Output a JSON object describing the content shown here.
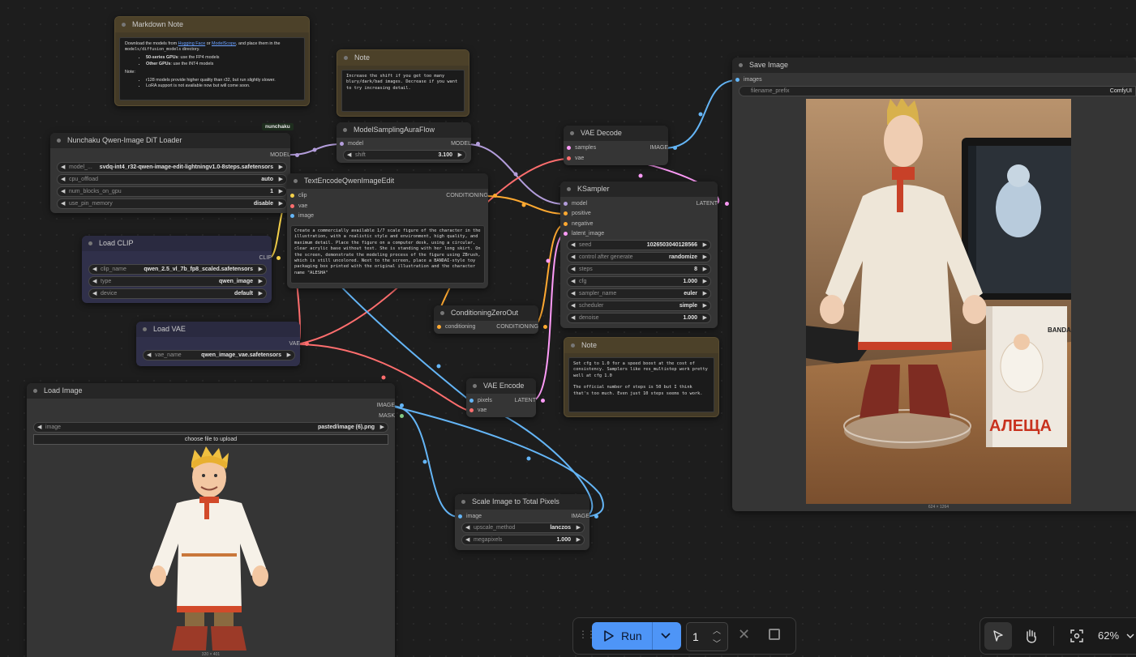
{
  "nodes": {
    "markdown_note": {
      "title": "Markdown Note",
      "p1_prefix": "Download the models from ",
      "link1": "Hugging Face",
      "p1_or": " or ",
      "link2": "ModelScope",
      "p1_suffix": ", and place them in the ",
      "p1_code": "models/diffusion_models",
      "p1_end": " directory.",
      "li1_bold": "50-series GPUs",
      "li1_rest": ": use the FP4 models",
      "li2_bold": "Other GPUs",
      "li2_rest": ": use the INT4 models",
      "note_label": "Note:",
      "li3": "r128 models provide higher quality than r32, but run slightly slower.",
      "li4": "LoRA support is not available now but will come soon."
    },
    "note_shift": {
      "title": "Note",
      "text": "Increase the shift if you get too many blury/dark/bad images. Decrease if you want to try increasing detail."
    },
    "badge": "nunchaku",
    "dit_loader": {
      "title": "Nunchaku Qwen-Image DiT Loader",
      "out": "MODEL",
      "widgets": [
        {
          "label": "model_...",
          "value": "svdq-int4_r32-qwen-image-edit-lightningv1.0-8steps.safetensors"
        },
        {
          "label": "cpu_offload",
          "value": "auto"
        },
        {
          "label": "num_blocks_on_gpu",
          "value": "1"
        },
        {
          "label": "use_pin_memory",
          "value": "disable"
        }
      ]
    },
    "model_sampling": {
      "title": "ModelSamplingAuraFlow",
      "in_model": "model",
      "out_model": "MODEL",
      "widget_label": "shift",
      "widget_value": "3.100"
    },
    "text_encode": {
      "title": "TextEncodeQwenImageEdit",
      "in_clip": "clip",
      "in_vae": "vae",
      "in_image": "image",
      "out": "CONDITIONING",
      "prompt": "Create a commercially available 1/7 scale figure of the character in the illustration, with a realistic style and environment, high quality, and maximum detail. Place the figure on a computer desk, using a circular, clear acrylic base without text. She is standing with her long skirt. On the screen, demonstrate the modeling process of the figure using ZBrush, which is still uncolored. Next to the screen, place a BANDAI-style toy packaging box printed with the original illustration and the character name \"ALESHA\""
    },
    "load_clip": {
      "title": "Load CLIP",
      "out": "CLIP",
      "widgets": [
        {
          "label": "clip_name",
          "value": "qwen_2.5_vl_7b_fp8_scaled.safetensors"
        },
        {
          "label": "type",
          "value": "qwen_image"
        },
        {
          "label": "device",
          "value": "default"
        }
      ]
    },
    "load_vae": {
      "title": "Load VAE",
      "out": "VAE",
      "widget_label": "vae_name",
      "widget_value": "qwen_image_vae.safetensors"
    },
    "load_image": {
      "title": "Load Image",
      "out_image": "IMAGE",
      "out_mask": "MASK",
      "widget_label": "image",
      "widget_value": "pasted/image (6).png",
      "upload_label": "choose file to upload",
      "caption": "320 × 401"
    },
    "vae_decode": {
      "title": "VAE Decode",
      "in_samples": "samples",
      "in_vae": "vae",
      "out": "IMAGE"
    },
    "ksampler": {
      "title": "KSampler",
      "in_model": "model",
      "in_positive": "positive",
      "in_negative": "negative",
      "in_latent": "latent_image",
      "out": "LATENT",
      "widgets": [
        {
          "label": "seed",
          "value": "1026503040128566"
        },
        {
          "label": "control after generate",
          "value": "randomize"
        },
        {
          "label": "steps",
          "value": "8"
        },
        {
          "label": "cfg",
          "value": "1.000"
        },
        {
          "label": "sampler_name",
          "value": "euler"
        },
        {
          "label": "scheduler",
          "value": "simple"
        },
        {
          "label": "denoise",
          "value": "1.000"
        }
      ]
    },
    "cond_zero": {
      "title": "ConditioningZeroOut",
      "in": "conditioning",
      "out": "CONDITIONING"
    },
    "note_cfg": {
      "title": "Note",
      "p1": "Set cfg to 1.0 for a speed boost at the cost of consistency. Samplers like res_multistep work pretty well at cfg 1.0",
      "p2": "The official number of steps is 50 but I think that's too much. Even just 10 steps seems to work."
    },
    "vae_encode": {
      "title": "VAE Encode",
      "in_pixels": "pixels",
      "in_vae": "vae",
      "out": "LATENT"
    },
    "scale_image": {
      "title": "Scale Image to Total Pixels",
      "in_image": "image",
      "out": "IMAGE",
      "widgets": [
        {
          "label": "upscale_method",
          "value": "lanczos"
        },
        {
          "label": "megapixels",
          "value": "1.000"
        }
      ]
    },
    "save_image": {
      "title": "Save Image",
      "in_images": "images",
      "widget_label": "filename_prefix",
      "widget_value": "ComfyUI",
      "caption": "624 × 1264",
      "box_text": "АЛЕЩА",
      "box_brand": "BANDAI"
    }
  },
  "toolbar": {
    "run_label": "Run",
    "batch_count": "1",
    "zoom": "62%"
  },
  "colors": {
    "model": "#b39ddb",
    "clip": "#f5d14a",
    "vae": "#ff6e6e",
    "image": "#64b5f6",
    "latent": "#ff9cf9",
    "conditioning": "#ffa931",
    "mask": "#81c784",
    "accent": "#4e95f7"
  }
}
